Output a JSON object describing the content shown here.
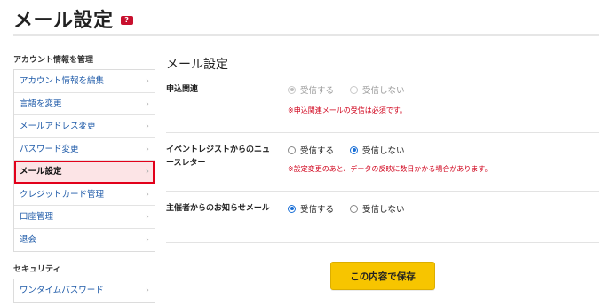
{
  "header": {
    "title": "メール設定",
    "help_badge": "?",
    "help_icon": "help-badge-icon"
  },
  "sidebar": {
    "account_heading": "アカウント情報を管理",
    "account_items": [
      {
        "label": "アカウント情報を編集",
        "active": false
      },
      {
        "label": "言語を変更",
        "active": false
      },
      {
        "label": "メールアドレス変更",
        "active": false
      },
      {
        "label": "パスワード変更",
        "active": false
      },
      {
        "label": "メール設定",
        "active": true
      },
      {
        "label": "クレジットカード管理",
        "active": false
      },
      {
        "label": "口座管理",
        "active": false
      },
      {
        "label": "退会",
        "active": false
      }
    ],
    "security_heading": "セキュリティ",
    "security_items": [
      {
        "label": "ワンタイムパスワード",
        "active": false
      }
    ],
    "chevron": "›"
  },
  "main": {
    "title": "メール設定",
    "settings": [
      {
        "label": "申込関連",
        "options": [
          {
            "label": "受信する",
            "checked": true,
            "disabled": true
          },
          {
            "label": "受信しない",
            "checked": false,
            "disabled": true
          }
        ],
        "note": "※申込関連メールの受信は必須です。"
      },
      {
        "label": "イベントレジストからのニュースレター",
        "options": [
          {
            "label": "受信する",
            "checked": false,
            "disabled": false
          },
          {
            "label": "受信しない",
            "checked": true,
            "disabled": false
          }
        ],
        "note": "※設定変更のあと、データの反映に数日かかる場合があります。"
      },
      {
        "label": "主催者からのお知らせメール",
        "options": [
          {
            "label": "受信する",
            "checked": true,
            "disabled": false
          },
          {
            "label": "受信しない",
            "checked": false,
            "disabled": false
          }
        ],
        "note": ""
      }
    ],
    "save_label": "この内容で保存"
  },
  "colors": {
    "accent_red": "#e2001a",
    "active_bg": "#fce4e6",
    "link_blue": "#1e5aa8",
    "radio_blue": "#1a6fd6",
    "note_red": "#d0021b",
    "save_yellow": "#f7c500"
  }
}
